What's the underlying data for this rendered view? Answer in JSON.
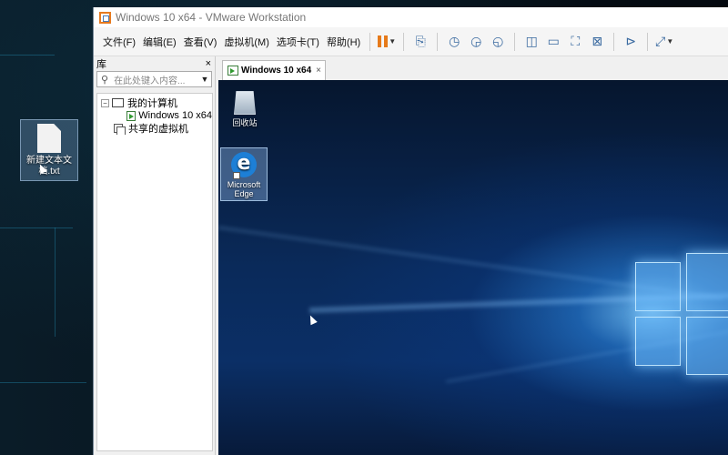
{
  "host": {
    "file_label": "新建文本文档.txt"
  },
  "window": {
    "title": "Windows 10 x64 - VMware Workstation"
  },
  "menu": [
    {
      "label": "文件(F)"
    },
    {
      "label": "编辑(E)"
    },
    {
      "label": "查看(V)"
    },
    {
      "label": "虚拟机(M)"
    },
    {
      "label": "选项卡(T)"
    },
    {
      "label": "帮助(H)"
    }
  ],
  "toolbar": {
    "icons": [
      "pause-icon",
      "send-ctrl-alt-del-icon",
      "snapshot-icon",
      "revert-snapshot-icon",
      "snapshot-manager-icon",
      "library-view-icon",
      "thumbnail-view-icon",
      "fullscreen-icon",
      "unity-icon",
      "console-icon",
      "stretch-icon"
    ],
    "accent": "#e67a1a"
  },
  "library": {
    "title": "库",
    "close": "×",
    "search_placeholder": "在此处键入内容...",
    "tree": {
      "root_toggle": "−",
      "root_label": "我的计算机",
      "vm_label": "Windows 10 x64",
      "shared_label": "共享的虚拟机"
    }
  },
  "tab": {
    "label": "Windows 10 x64",
    "close": "×"
  },
  "guest": {
    "recycle_label": "回收站",
    "edge_label_line1": "Microsoft",
    "edge_label_line2": "Edge",
    "edge_glyph": "e"
  }
}
